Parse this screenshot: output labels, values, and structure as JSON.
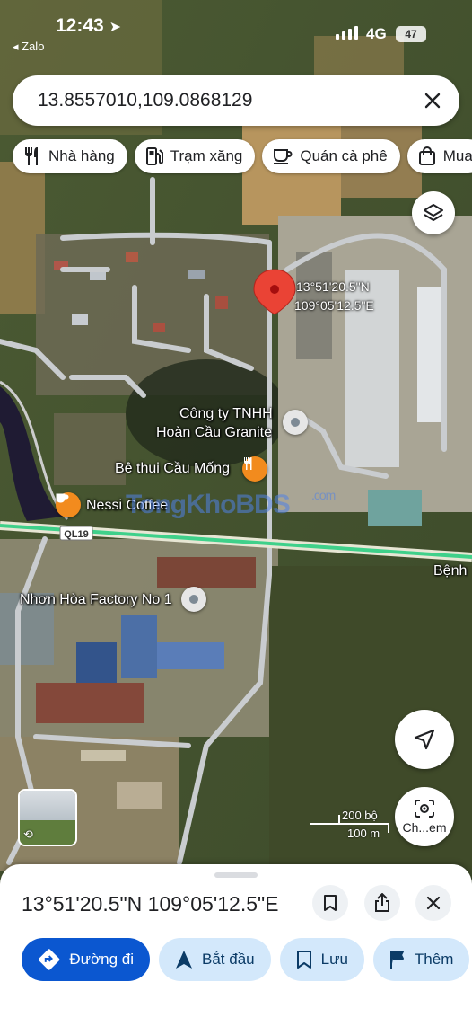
{
  "status_bar": {
    "time": "12:43",
    "back_app": "◂ Zalo",
    "network": "4G",
    "battery": "47"
  },
  "search": {
    "query": "13.8557010,109.0868129"
  },
  "chips": [
    {
      "label": "Nhà hàng",
      "icon": "fork-knife-icon"
    },
    {
      "label": "Trạm xăng",
      "icon": "gas-station-icon"
    },
    {
      "label": "Quán cà phê",
      "icon": "coffee-cup-icon"
    },
    {
      "label": "Mua",
      "icon": "shopping-bag-icon"
    }
  ],
  "map": {
    "dropped_pin": {
      "lat_dms": "13°51'20.5\"N",
      "lon_dms": "109°05'12.5\"E"
    },
    "pois": [
      {
        "line1": "Công ty TNHH",
        "line2": "Hoàn Cầu Granite",
        "pin": "gray"
      },
      {
        "line1": "Bê thui Cầu Mống",
        "pin": "restaurant"
      },
      {
        "line1": "Nessi Coffee",
        "pin": "coffee"
      },
      {
        "line1": "Nhơn Hòa Factory No 1",
        "pin": "gray"
      },
      {
        "line1": "Bệnh"
      }
    ],
    "road_label": "QL19",
    "watermark": "TongKhoBDS",
    "watermark_suffix": ".com",
    "scale": {
      "imperial": "200 bộ",
      "metric": "100 m"
    },
    "lens_label": "Ch...em"
  },
  "sheet": {
    "title": "13°51'20.5\"N 109°05'12.5\"E",
    "actions": [
      {
        "label": "Đường đi",
        "icon": "directions-icon"
      },
      {
        "label": "Bắt đầu",
        "icon": "navigation-arrow-icon"
      },
      {
        "label": "Lưu",
        "icon": "bookmark-icon"
      },
      {
        "label": "Thêm",
        "icon": "flag-icon"
      }
    ]
  },
  "colors": {
    "primary_button": "#0b57d0",
    "secondary_button": "#d3e8fb",
    "pin_red": "#ea4335",
    "restaurant_orange": "#f28b1e",
    "highway_green": "#3fd08a"
  }
}
